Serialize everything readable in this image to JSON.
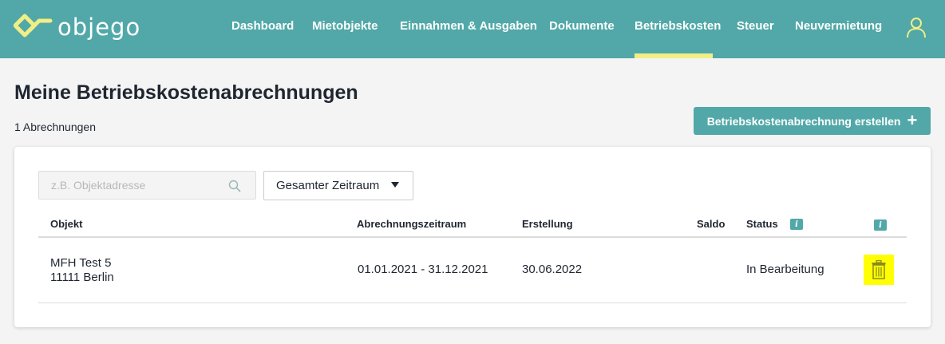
{
  "app": {
    "brand": "objego",
    "colors": {
      "header": "#52a8a8",
      "active": "#f2ee86",
      "accent": "#52a8a8",
      "highlight": "#ffff00"
    }
  },
  "nav": {
    "items": [
      {
        "label": "Dashboard"
      },
      {
        "label": "Mietobjekte"
      },
      {
        "label": "Einnahmen & Ausgaben"
      },
      {
        "label": "Dokumente"
      },
      {
        "label": "Betriebskosten",
        "active": true
      },
      {
        "label": "Steuer"
      },
      {
        "label": "Neuvermietung"
      }
    ],
    "user_icon": "user-icon"
  },
  "page": {
    "title": "Meine Betriebskostenabrechnungen",
    "count": "1 Abrechnungen",
    "create_button": "Betriebskostenabrechnung erstellen",
    "create_icon": "plus-icon"
  },
  "filters": {
    "search_placeholder": "z.B. Objektadresse",
    "search_value": "",
    "period_selected": "Gesamter Zeitraum"
  },
  "table": {
    "headers": {
      "object": "Objekt",
      "period": "Abrechnungszeitraum",
      "created": "Erstellung",
      "balance": "Saldo",
      "status": "Status"
    },
    "info_icon_label": "i",
    "rows": [
      {
        "object_line1": "MFH Test 5",
        "object_line2": "11111 Berlin",
        "period": "01.01.2021 - 31.12.2021",
        "created": "30.06.2022",
        "balance": "",
        "status": "In Bearbeitung",
        "action_icon": "trash-icon"
      }
    ]
  }
}
